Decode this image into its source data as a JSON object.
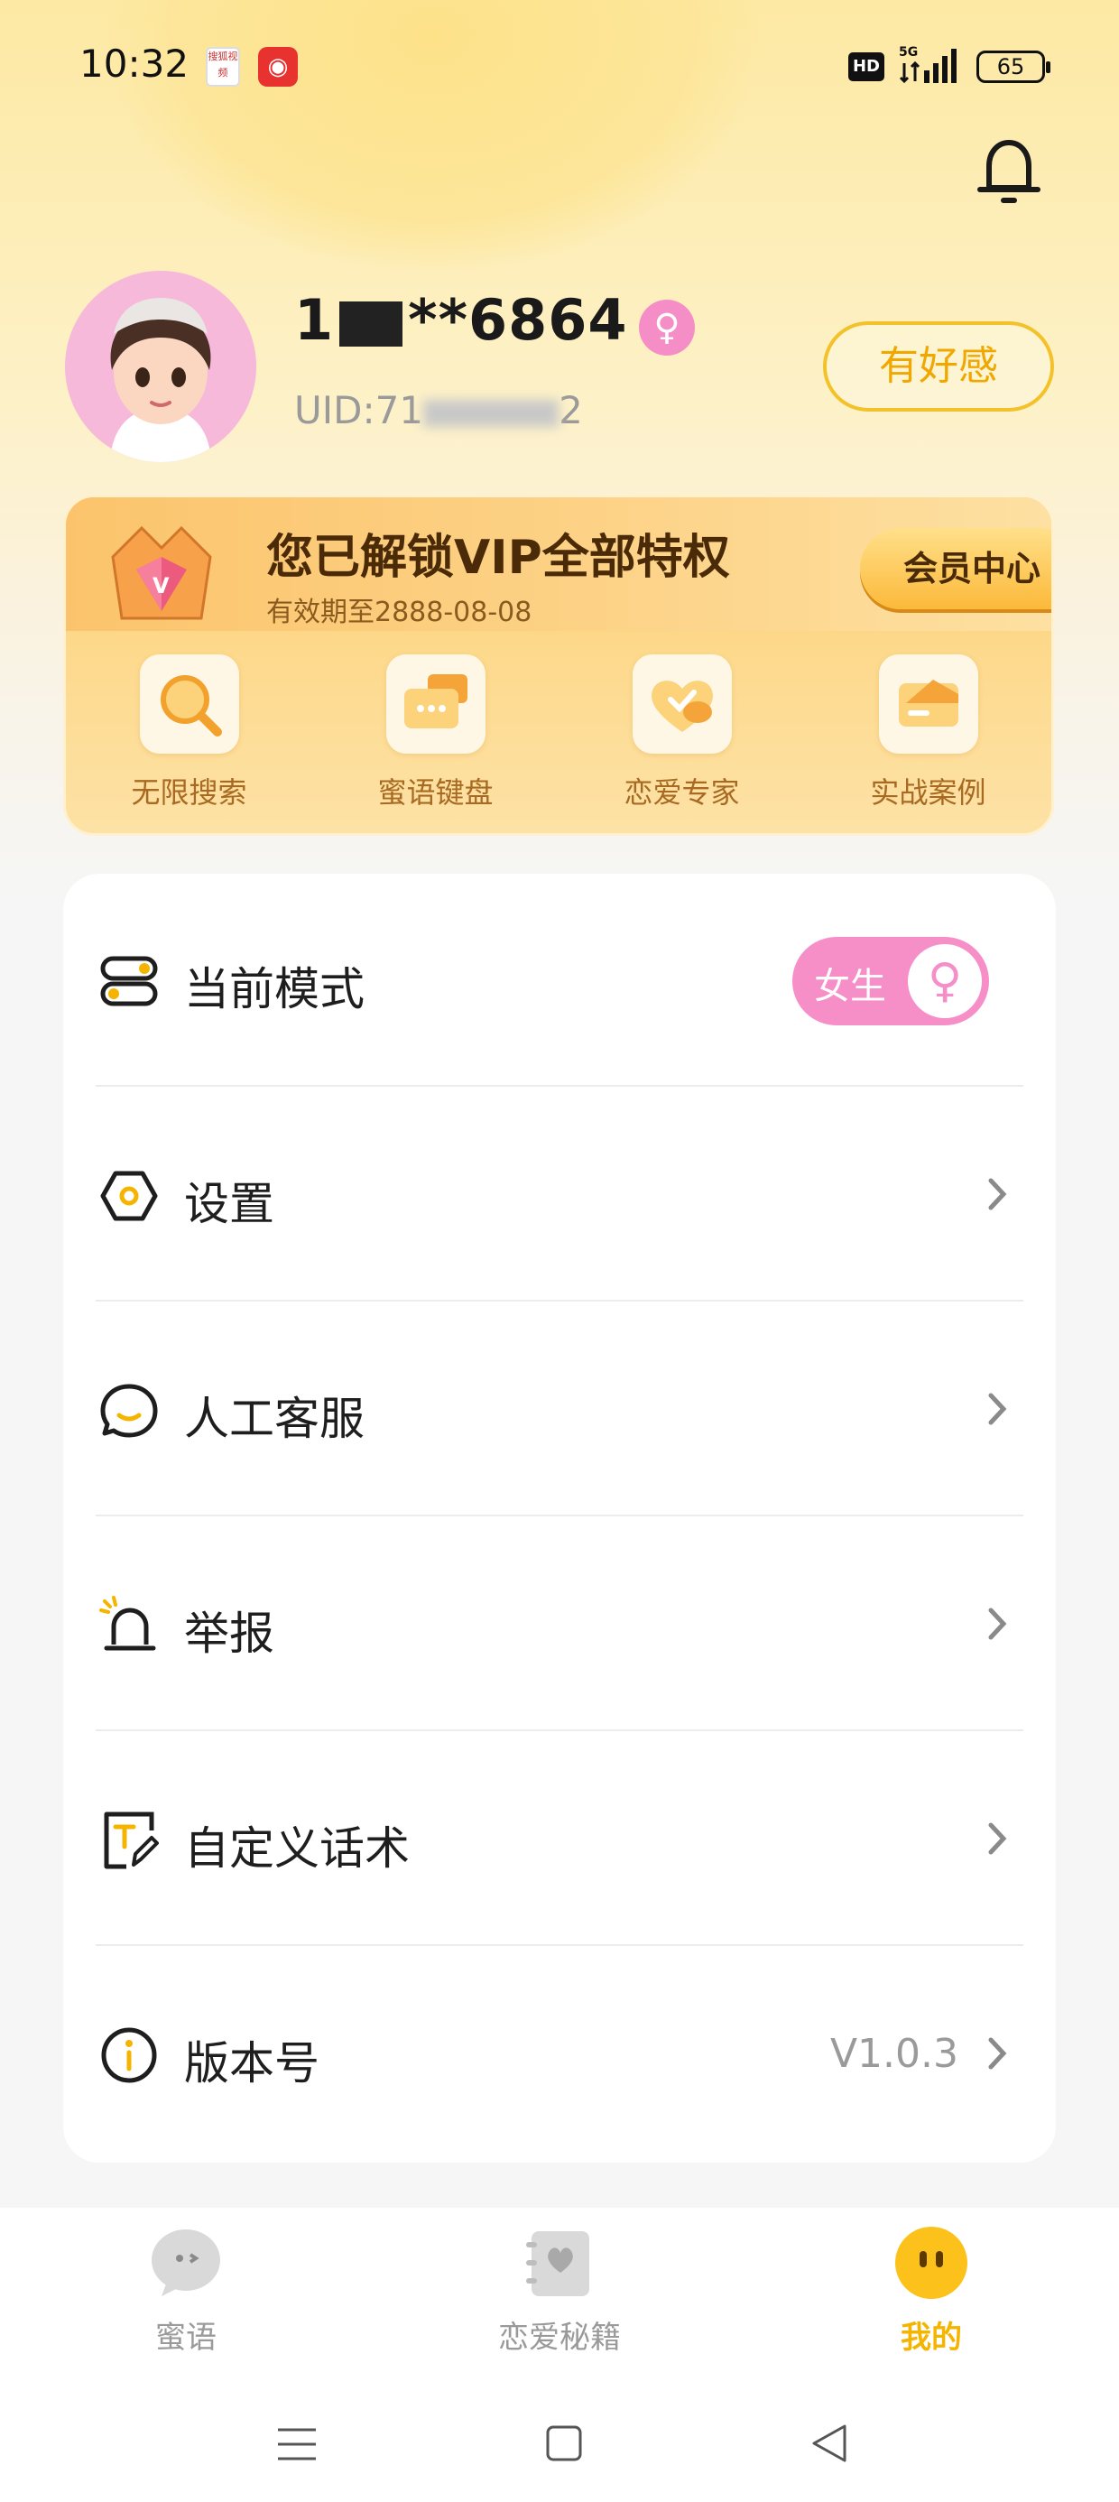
{
  "status_bar": {
    "time": "10:32",
    "notif_a_text": "搜狐视频",
    "notif_b_icon": "netease-music-icon",
    "hd": "HD",
    "network": "5G",
    "battery": "65"
  },
  "profile": {
    "username_prefix": "1",
    "username_suffix": "**6864",
    "gender_symbol": "♀",
    "uid_prefix": "UID:71",
    "uid_suffix": "2",
    "likes_button": "有好感"
  },
  "vip": {
    "title": "您已解锁VIP全部特权",
    "expiry": "有效期至2888-08-08",
    "member_center": "会员中心",
    "features": [
      {
        "label": "无限搜索",
        "icon": "search-icon"
      },
      {
        "label": "蜜语键盘",
        "icon": "keyboard-icon"
      },
      {
        "label": "恋爱专家",
        "icon": "heart-icon"
      },
      {
        "label": "实战案例",
        "icon": "card-icon"
      }
    ]
  },
  "settings": {
    "rows": [
      {
        "label": "当前模式",
        "icon": "toggle-mode-icon"
      },
      {
        "label": "设置",
        "icon": "gear-icon"
      },
      {
        "label": "人工客服",
        "icon": "chat-icon"
      },
      {
        "label": "举报",
        "icon": "alarm-icon"
      },
      {
        "label": "自定义话术",
        "icon": "edit-text-icon"
      },
      {
        "label": "版本号",
        "icon": "info-icon"
      }
    ],
    "mode_value": "女生",
    "mode_symbol": "♀",
    "version_value": "V1.0.3"
  },
  "bottom_nav": {
    "items": [
      {
        "label": "蜜语",
        "icon": "chat-bubble-icon",
        "active": false
      },
      {
        "label": "恋爱秘籍",
        "icon": "book-icon",
        "active": false
      },
      {
        "label": "我的",
        "icon": "smiley-icon",
        "active": true
      }
    ]
  },
  "colors": {
    "accent_yellow": "#f5b400",
    "pink": "#f68ec8",
    "vip_gold": "#fcc86a"
  }
}
